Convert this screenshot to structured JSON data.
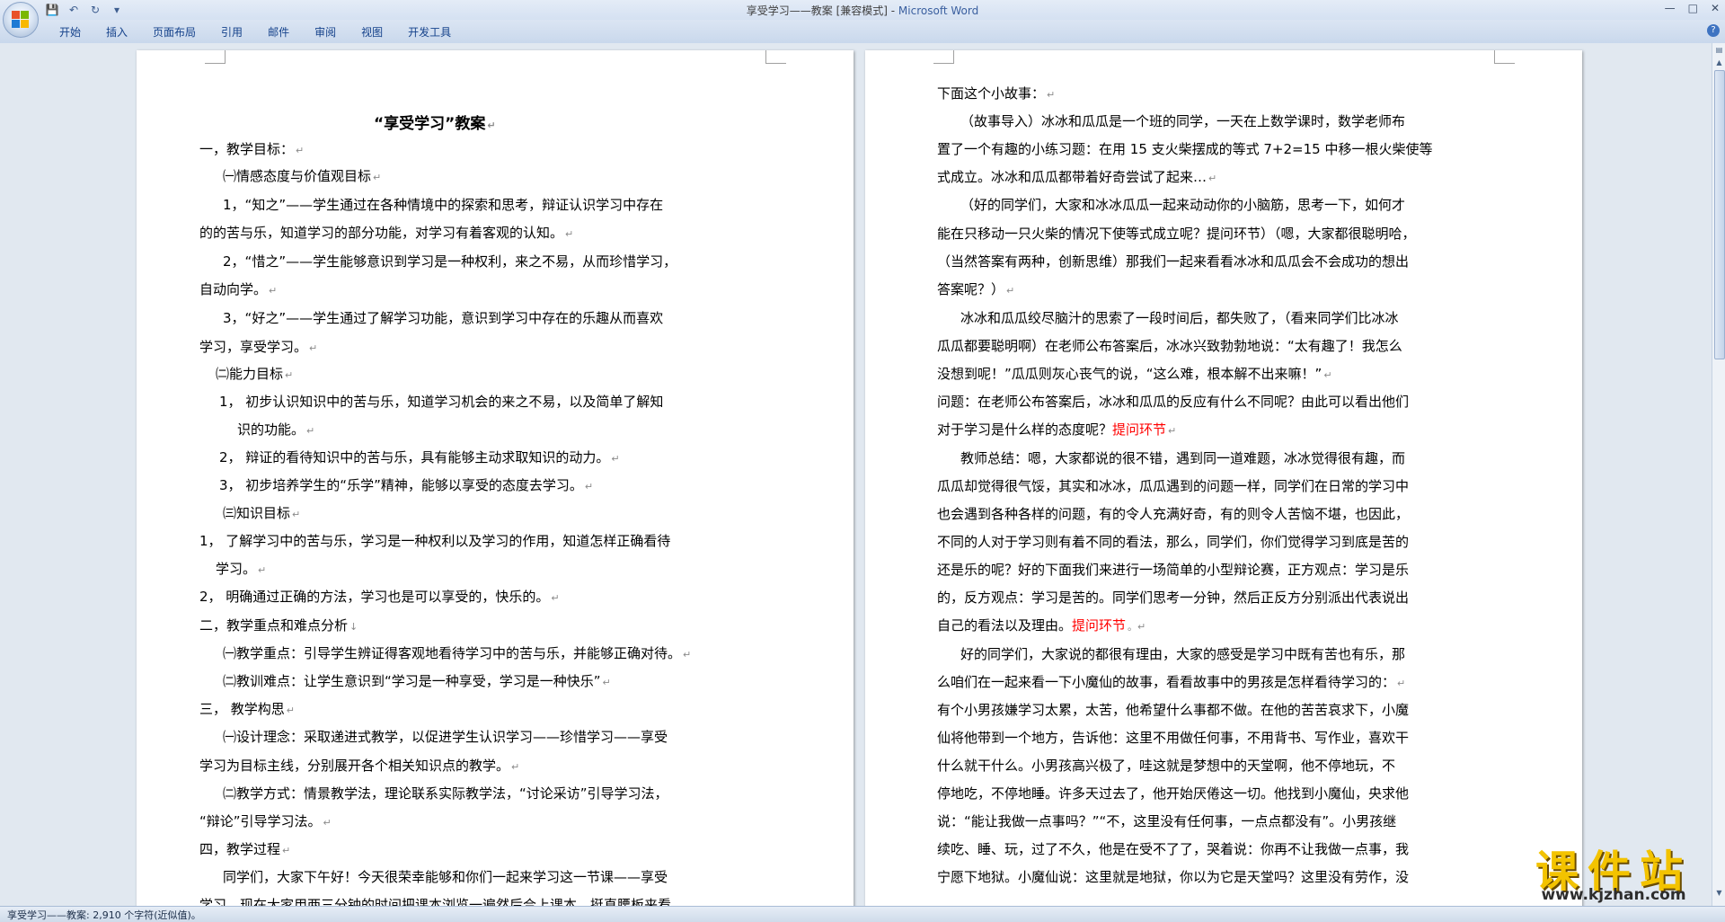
{
  "window": {
    "title_doc": "享受学习——教案 [兼容模式] - ",
    "title_app": "Microsoft Word"
  },
  "qat": {
    "save": "💾",
    "undo": "↶",
    "redo": "↻",
    "more": "▾"
  },
  "ribbon": {
    "tabs": [
      "开始",
      "插入",
      "页面布局",
      "引用",
      "邮件",
      "审阅",
      "视图",
      "开发工具"
    ]
  },
  "window_controls": {
    "minimize": "—",
    "maximize": "□",
    "close": "✕",
    "help": "?"
  },
  "page1": {
    "lines": [
      {
        "text": "“享受学习”教案",
        "mark": "↵",
        "title": true
      },
      {
        "text": "一，教学目标：",
        "mark": "↵"
      },
      {
        "text": "㈠情感态度与价值观目标",
        "mark": "↵"
      },
      {
        "text": "1，“知之”——学生通过在各种情境中的探索和思考，辩证认识学习中存在",
        "mark": ""
      },
      {
        "text": "的的苦与乐，知道学习的部分功能，对学习有着客观的认知。",
        "mark": "↵"
      },
      {
        "text": "2，“惜之”——学生能够意识到学习是一种权利，来之不易，从而珍惜学习，",
        "mark": ""
      },
      {
        "text": "自动向学。",
        "mark": "↵"
      },
      {
        "text": "3，“好之”——学生通过了解学习功能，意识到学习中存在的乐趣从而喜欢",
        "mark": ""
      },
      {
        "text": "学习，享受学习。",
        "mark": "↵"
      },
      {
        "text": "㈡能力目标",
        "mark": "↵"
      },
      {
        "text": "1，  初步认识知识中的苦与乐，知道学习机会的来之不易，以及简单了解知",
        "mark": ""
      },
      {
        "text": "识的功能。",
        "mark": "↵"
      },
      {
        "text": "2，  辩证的看待知识中的苦与乐，具有能够主动求取知识的动力。",
        "mark": "↵"
      },
      {
        "text": "3，  初步培养学生的“乐学”精神，能够以享受的态度去学习。",
        "mark": "↵"
      },
      {
        "text": "㈢知识目标",
        "mark": "↵"
      },
      {
        "text": "1，  了解学习中的苦与乐，学习是一种权利以及学习的作用，知道怎样正确看待",
        "mark": ""
      },
      {
        "text": "学习。",
        "mark": "↵"
      },
      {
        "text": "2，  明确通过正确的方法，学习也是可以享受的，快乐的。",
        "mark": "↵"
      },
      {
        "text": "二，教学重点和难点分析",
        "mark": "↓"
      },
      {
        "text": "㈠教学重点：引导学生辨证得客观地看待学习中的苦与乐，并能够正确对待。",
        "mark": "↵"
      },
      {
        "text": "㈡教训难点：让学生意识到“学习是一种享受，学习是一种快乐”",
        "mark": "↵"
      },
      {
        "text": "三，  教学构思",
        "mark": "↵"
      },
      {
        "text": "㈠设计理念：采取递进式教学，以促进学生认识学习——珍惜学习——享受",
        "mark": ""
      },
      {
        "text": "学习为目标主线，分别展开各个相关知识点的教学。",
        "mark": "↵"
      },
      {
        "text": "㈡教学方式：情景教学法，理论联系实际教学法，“讨论采访”引导学习法，",
        "mark": ""
      },
      {
        "text": "“辩论”引导学习法。",
        "mark": "↵"
      },
      {
        "text": "四，教学过程",
        "mark": "↵"
      },
      {
        "text": "同学们，大家下午好！今天很荣幸能够和你们一起来学习这一节课——享受",
        "mark": ""
      },
      {
        "text": "学习，现在大家用两三分钟的时间把课本浏览一遍然后合上课本，挺直腰板来看",
        "mark": ""
      }
    ]
  },
  "page2": {
    "lines": [
      {
        "text": "下面这个小故事：",
        "red": "",
        "mark": "↵"
      },
      {
        "text": "（故事导入）冰冰和瓜瓜是一个班的同学，一天在上数学课时，数学老师布",
        "red": "",
        "mark": ""
      },
      {
        "text": "置了一个有趣的小练习题：在用 15 支火柴摆成的等式 7+2=15 中移一根火柴使等",
        "red": "",
        "mark": ""
      },
      {
        "text": "式成立。冰冰和瓜瓜都带着好奇尝试了起来…",
        "red": "",
        "mark": "↵"
      },
      {
        "text": "（好的同学们，大家和冰冰瓜瓜一起来动动你的小脑筋，思考一下，如何才",
        "red": "",
        "mark": ""
      },
      {
        "text": "能在只移动一只火柴的情况下使等式成立呢？提问环节）（嗯，大家都很聪明哈，",
        "red": "",
        "mark": ""
      },
      {
        "text": "（当然答案有两种，创新思维）那我们一起来看看冰冰和瓜瓜会不会成功的想出",
        "red": "",
        "mark": ""
      },
      {
        "text": "答案呢？）",
        "red": "",
        "mark": "↵"
      },
      {
        "text": "冰冰和瓜瓜绞尽脑汁的思索了一段时间后，都失败了，（看来同学们比冰冰",
        "red": "",
        "mark": ""
      },
      {
        "text": "瓜瓜都要聪明啊）在老师公布答案后，冰冰兴致勃勃地说：“太有趣了！我怎么",
        "red": "",
        "mark": ""
      },
      {
        "text": "没想到呢！”瓜瓜则灰心丧气的说，“这么难，根本解不出来嘛！”",
        "red": "",
        "mark": "↵"
      },
      {
        "text": "问题：在老师公布答案后，冰冰和瓜瓜的反应有什么不同呢？由此可以看出他们",
        "red": "",
        "mark": ""
      },
      {
        "text": "对于学习是什么样的态度呢？",
        "red": "提问环节",
        "mark": "↵"
      },
      {
        "text": "教师总结：嗯，大家都说的很不错，遇到同一道难题，冰冰觉得很有趣，而",
        "red": "",
        "mark": ""
      },
      {
        "text": "瓜瓜却觉得很气馁，其实和冰冰，瓜瓜遇到的问题一样，同学们在日常的学习中",
        "red": "",
        "mark": ""
      },
      {
        "text": "也会遇到各种各样的问题，有的令人充满好奇，有的则令人苦恼不堪，也因此，",
        "red": "",
        "mark": ""
      },
      {
        "text": "不同的人对于学习则有着不同的看法，那么，同学们，你们觉得学习到底是苦的",
        "red": "",
        "mark": ""
      },
      {
        "text": "还是乐的呢？好的下面我们来进行一场简单的小型辩论赛，正方观点：学习是乐",
        "red": "",
        "mark": ""
      },
      {
        "text": "的，反方观点：学习是苦的。同学们思考一分钟，然后正反方分别派出代表说出",
        "red": "",
        "mark": ""
      },
      {
        "text": "自己的看法以及理由。",
        "red": "提问环节",
        "mark": "。↵"
      },
      {
        "text": "好的同学们，大家说的都很有理由，大家的感受是学习中既有苦也有乐，那",
        "red": "",
        "mark": ""
      },
      {
        "text": "么咱们在一起来看一下小魔仙的故事，看看故事中的男孩是怎样看待学习的：",
        "red": "",
        "mark": "↵"
      },
      {
        "text": "有个小男孩嫌学习太累，太苦，他希望什么事都不做。在他的苦苦哀求下，小魔",
        "red": "",
        "mark": ""
      },
      {
        "text": "仙将他带到一个地方，告诉他：这里不用做任何事，不用背书、写作业，喜欢干",
        "red": "",
        "mark": ""
      },
      {
        "text": "什么就干什么。小男孩高兴极了，哇这就是梦想中的天堂啊，他不停地玩，不",
        "red": "",
        "mark": ""
      },
      {
        "text": "停地吃，不停地睡。许多天过去了，他开始厌倦这一切。他找到小魔仙，央求他",
        "red": "",
        "mark": ""
      },
      {
        "text": "说：“能让我做一点事吗？”“不，这里没有任何事，一点点都没有”。小男孩继",
        "red": "",
        "mark": ""
      },
      {
        "text": "续吃、睡、玩，过了不久，他是在受不了了，哭着说：你再不让我做一点事，我",
        "red": "",
        "mark": ""
      },
      {
        "text": "宁愿下地狱。小魔仙说：这里就是地狱，你以为它是天堂吗？这里没有劳作，没",
        "red": "",
        "mark": ""
      }
    ]
  },
  "statusbar": {
    "text": "享受学习——教案: 2,910 个字符(近似值)。"
  },
  "watermark": {
    "title": "课件站",
    "url": "www.kjzhan.com"
  },
  "colors": {
    "ribbon_text": "#15428b",
    "red_text": "#ff0000",
    "watermark_gold": "#f3c300"
  }
}
